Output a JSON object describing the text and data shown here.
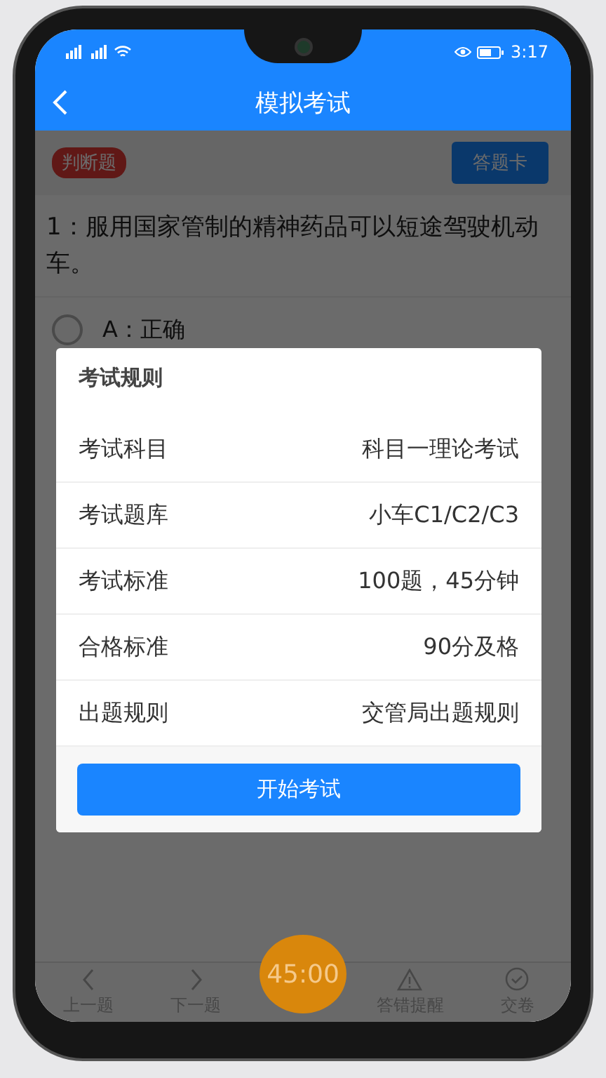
{
  "status_bar": {
    "time": "3:17"
  },
  "header": {
    "title": "模拟考试"
  },
  "question": {
    "type_tag": "判断题",
    "answer_card_button": "答题卡",
    "text": "1：服用国家管制的精神药品可以短途驾驶机动车。",
    "options": [
      {
        "label": "A：正确",
        "selected": false
      }
    ]
  },
  "overlay": {
    "dimmed": true
  },
  "dialog": {
    "title": "考试规则",
    "rows": [
      {
        "label": "考试科目",
        "value": "科目一理论考试"
      },
      {
        "label": "考试题库",
        "value": "小车C1/C2/C3"
      },
      {
        "label": "考试标准",
        "value": "100题，45分钟"
      },
      {
        "label": "合格标准",
        "value": "90分及格"
      },
      {
        "label": "出题规则",
        "value": "交管局出题规则"
      }
    ],
    "button": "开始考试"
  },
  "bottom_bar": {
    "items": [
      {
        "kind": "prev",
        "label": "上一题"
      },
      {
        "kind": "next",
        "label": "下一题"
      },
      {
        "kind": "timer",
        "label": "45:00"
      },
      {
        "kind": "warning",
        "label": "答错提醒"
      },
      {
        "kind": "submit",
        "label": "交卷"
      }
    ]
  }
}
